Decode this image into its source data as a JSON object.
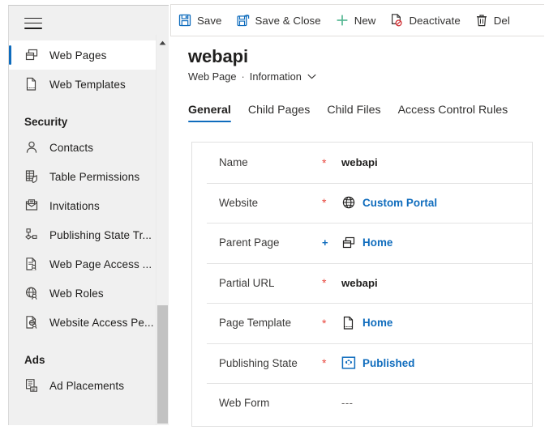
{
  "sidebar": {
    "menu_icon": "hamburger-icon",
    "items": [
      {
        "type": "item",
        "label": "Web Pages",
        "icon": "web-pages-icon",
        "selected": true
      },
      {
        "type": "item",
        "label": "Web Templates",
        "icon": "web-template-icon",
        "selected": false
      },
      {
        "type": "group",
        "label": "Security"
      },
      {
        "type": "item",
        "label": "Contacts",
        "icon": "contact-person-icon",
        "selected": false
      },
      {
        "type": "item",
        "label": "Table  Permissions",
        "icon": "table-permissions-icon",
        "selected": false
      },
      {
        "type": "item",
        "label": "Invitations",
        "icon": "invitation-envelope-icon",
        "selected": false
      },
      {
        "type": "item",
        "label": "Publishing State Tr...",
        "icon": "publishing-state-transition-icon",
        "selected": false
      },
      {
        "type": "item",
        "label": "Web Page Access ...",
        "icon": "web-page-access-icon",
        "selected": false
      },
      {
        "type": "item",
        "label": "Web Roles",
        "icon": "web-roles-globe-icon",
        "selected": false
      },
      {
        "type": "item",
        "label": "Website Access Pe...",
        "icon": "website-access-icon",
        "selected": false
      },
      {
        "type": "group",
        "label": "Ads"
      },
      {
        "type": "item",
        "label": "Ad Placements",
        "icon": "ad-placements-icon",
        "selected": false
      }
    ],
    "scroll_up_icon": "chevron-up-icon"
  },
  "commandbar": {
    "buttons": [
      {
        "label": "Save",
        "icon": "save-floppy-icon",
        "color": "#0f6cbd"
      },
      {
        "label": "Save & Close",
        "icon": "save-and-close-icon",
        "color": "#0f6cbd"
      },
      {
        "label": "New",
        "icon": "plus-icon",
        "color": "#57b894"
      },
      {
        "label": "Deactivate",
        "icon": "deactivate-icon",
        "color": "#323130"
      },
      {
        "label": "Del",
        "icon": "delete-trash-icon",
        "color": "#323130"
      }
    ]
  },
  "header": {
    "title": "webapi",
    "entity": "Web Page",
    "separator": "·",
    "form_name": "Information",
    "form_chevron": "chevron-down-icon"
  },
  "tabs": [
    {
      "label": "General",
      "active": true
    },
    {
      "label": "Child Pages",
      "active": false
    },
    {
      "label": "Child Files",
      "active": false
    },
    {
      "label": "Access Control Rules",
      "active": false
    }
  ],
  "form": {
    "rows": [
      {
        "label": "Name",
        "marker": "*",
        "marker_type": "star",
        "value": "webapi",
        "value_type": "text",
        "icon": null
      },
      {
        "label": "Website",
        "marker": "*",
        "marker_type": "star",
        "value": "Custom Portal",
        "value_type": "link",
        "icon": "globe-icon"
      },
      {
        "label": "Parent Page",
        "marker": "+",
        "marker_type": "plus",
        "value": "Home",
        "value_type": "link",
        "icon": "web-pages-icon"
      },
      {
        "label": "Partial URL",
        "marker": "*",
        "marker_type": "star",
        "value": "webapi",
        "value_type": "text",
        "icon": null
      },
      {
        "label": "Page Template",
        "marker": "*",
        "marker_type": "star",
        "value": "Home",
        "value_type": "link",
        "icon": "page-template-icon"
      },
      {
        "label": "Publishing State",
        "marker": "*",
        "marker_type": "star",
        "value": "Published",
        "value_type": "link",
        "icon": "publishing-state-icon"
      },
      {
        "label": "Web Form",
        "marker": "",
        "marker_type": "none",
        "value": "---",
        "value_type": "empty",
        "icon": null
      }
    ]
  },
  "colors": {
    "accent": "#0f6cbd",
    "required": "#e8453c",
    "new_green": "#57b894",
    "sidebar_bg": "#f0f0f0"
  }
}
